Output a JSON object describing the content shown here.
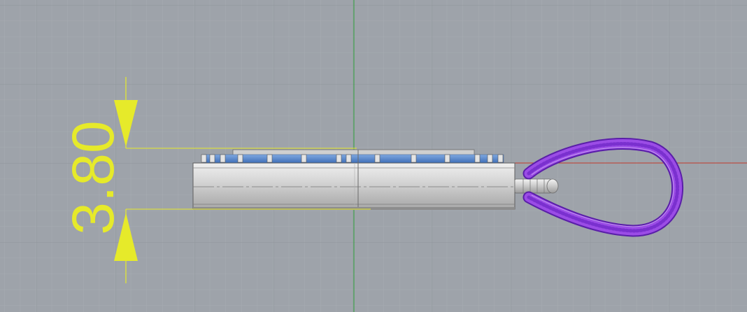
{
  "viewport": {
    "view": "front",
    "background_color": "#9ea3aa",
    "grid_minor_color": "#a9adb3",
    "grid_major_color": "#8f949b",
    "axis_y_color": "#2fa13a",
    "axis_x_color": "#c0392b"
  },
  "dimension": {
    "value_label": "3.80",
    "color": "#e6ea2a"
  },
  "model": {
    "body_color": "#d4d4d4",
    "stone_color": "#4a7fc6",
    "bail_color": "#8a3fd6"
  }
}
